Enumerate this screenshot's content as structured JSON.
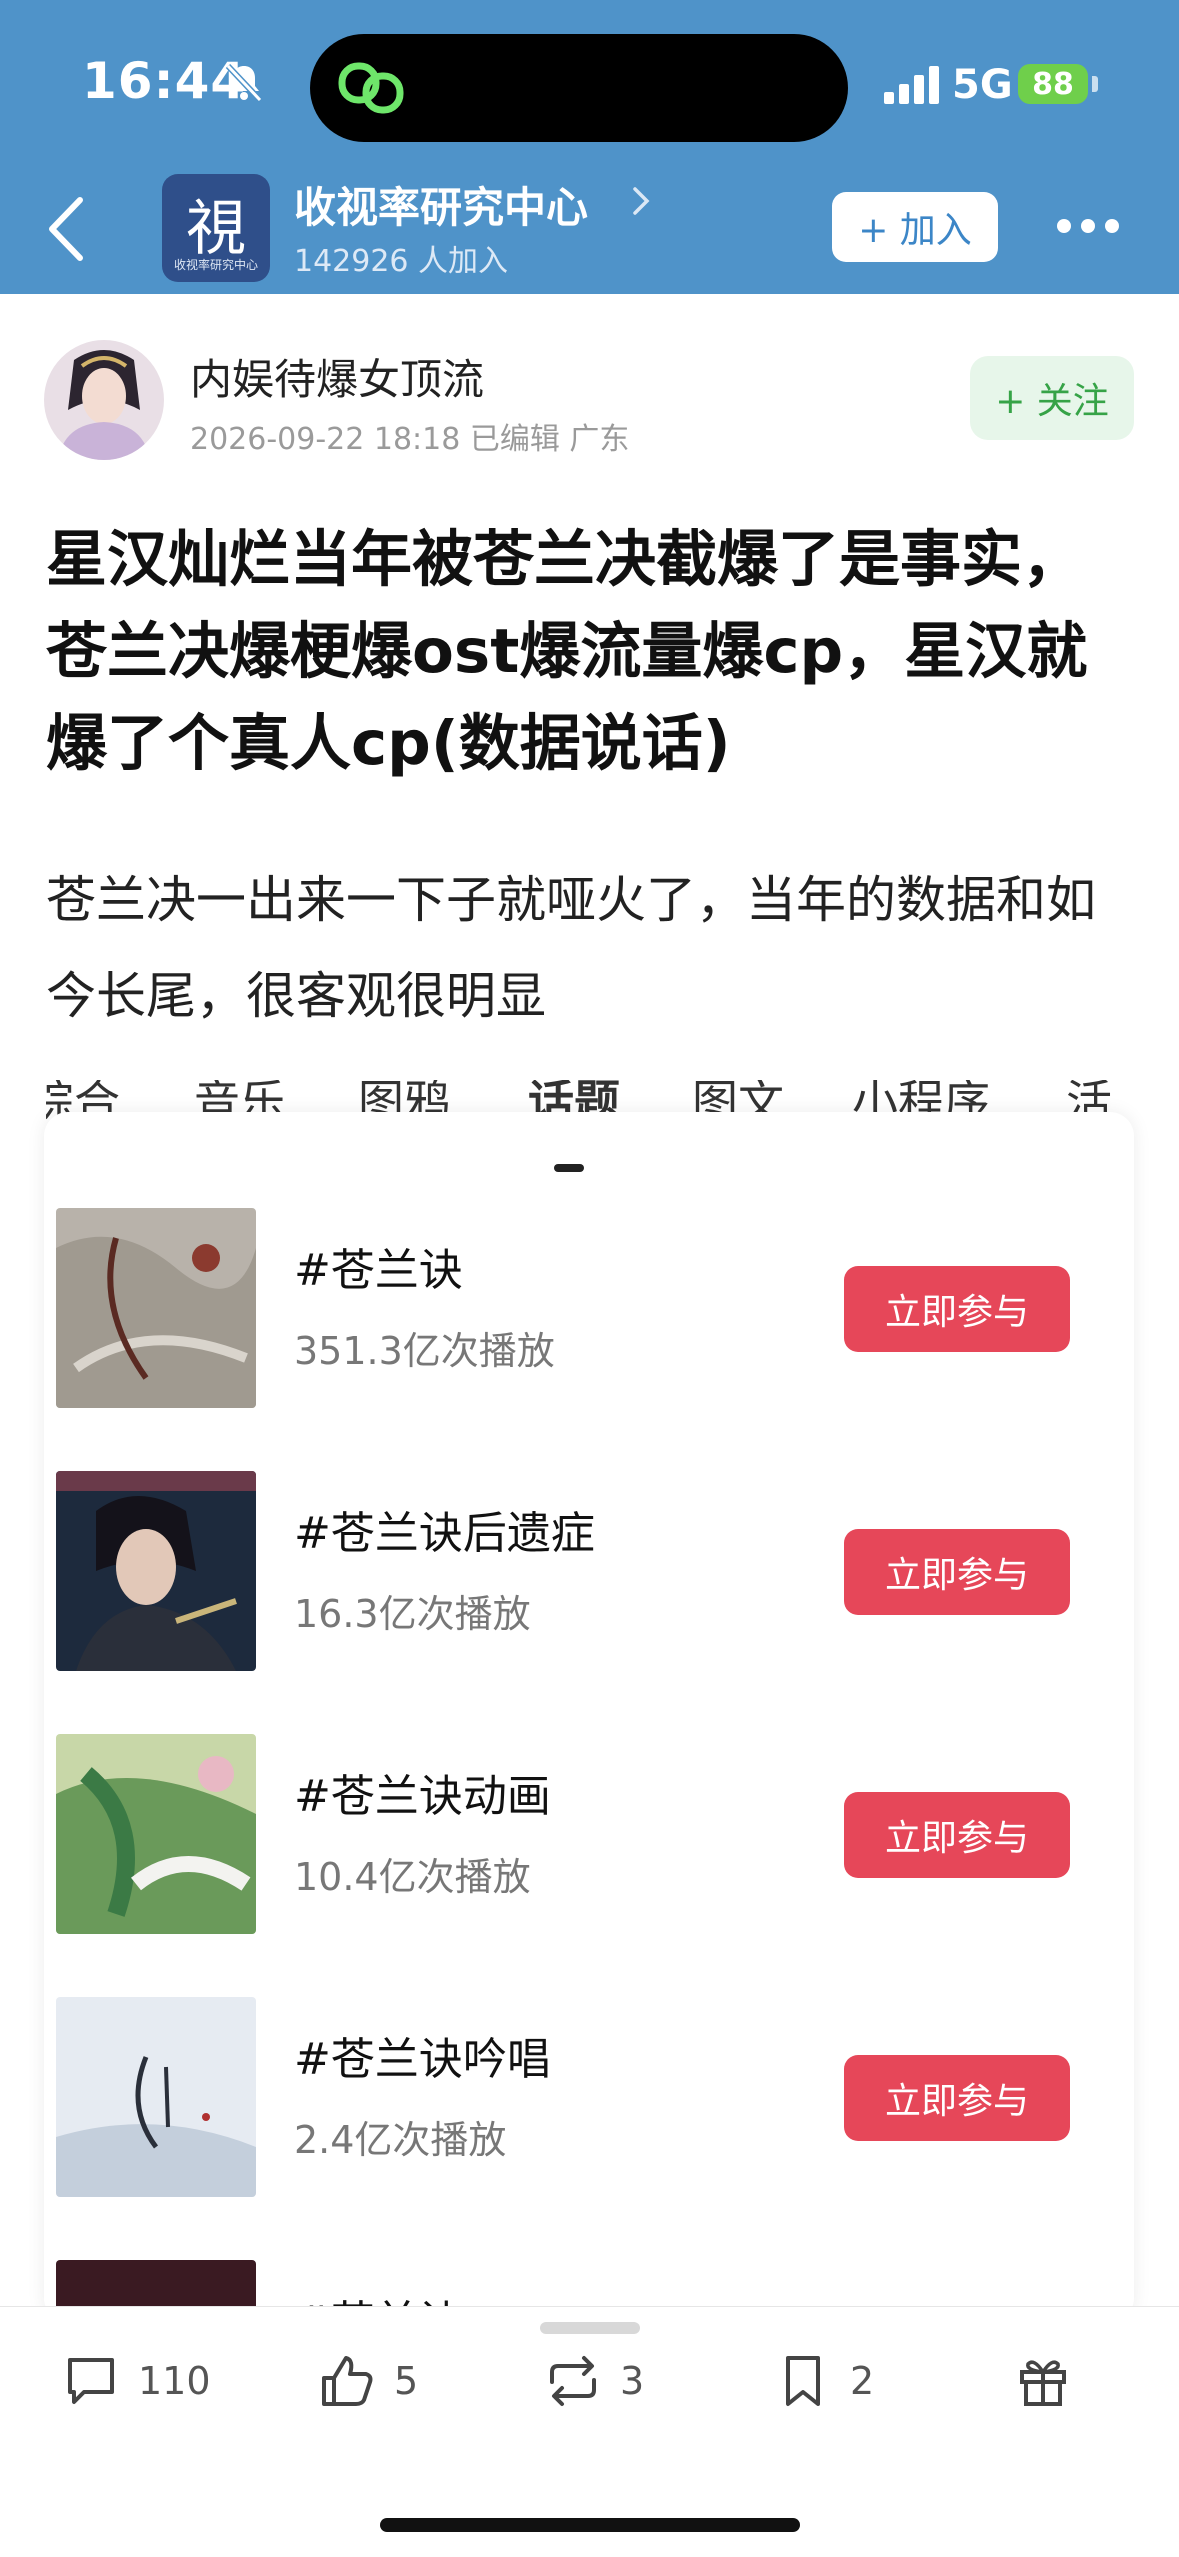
{
  "status_bar": {
    "time": "16:44",
    "network": "5G",
    "battery": "88"
  },
  "header": {
    "group_name": "收视率研究中心",
    "members": "142926 人加入",
    "join_label": "+ 加入",
    "avatar_char": "視",
    "avatar_subtext": "收视率研究中心"
  },
  "post": {
    "author": "内娱待爆女顶流",
    "meta": "2026-09-22 18:18  已编辑  广东",
    "follow_label": "+ 关注",
    "title": "星汉灿烂当年被苍兰决截爆了是事实，苍兰决爆梗爆ost爆流量爆cp，星汉就爆了个真人cp(数据说话)",
    "body": "苍兰决一出来一下子就哑火了，当年的数据和如今长尾，很客观很明显"
  },
  "tabs": [
    "综合",
    "音乐",
    "图鸦",
    "话题",
    "图文",
    "小程序",
    "活动"
  ],
  "topics": [
    {
      "name": "#苍兰诀",
      "plays": "351.3亿次播放",
      "button": "立即参与"
    },
    {
      "name": "#苍兰诀后遗症",
      "plays": "16.3亿次播放",
      "button": "立即参与"
    },
    {
      "name": "#苍兰诀动画",
      "plays": "10.4亿次播放",
      "button": "立即参与"
    },
    {
      "name": "#苍兰诀吟唱",
      "plays": "2.4亿次播放",
      "button": "立即参与"
    },
    {
      "name": "#苍兰诀",
      "plays": "",
      "button": ""
    }
  ],
  "actions": {
    "comments": "110",
    "likes": "5",
    "reposts": "3",
    "favorites": "2"
  }
}
